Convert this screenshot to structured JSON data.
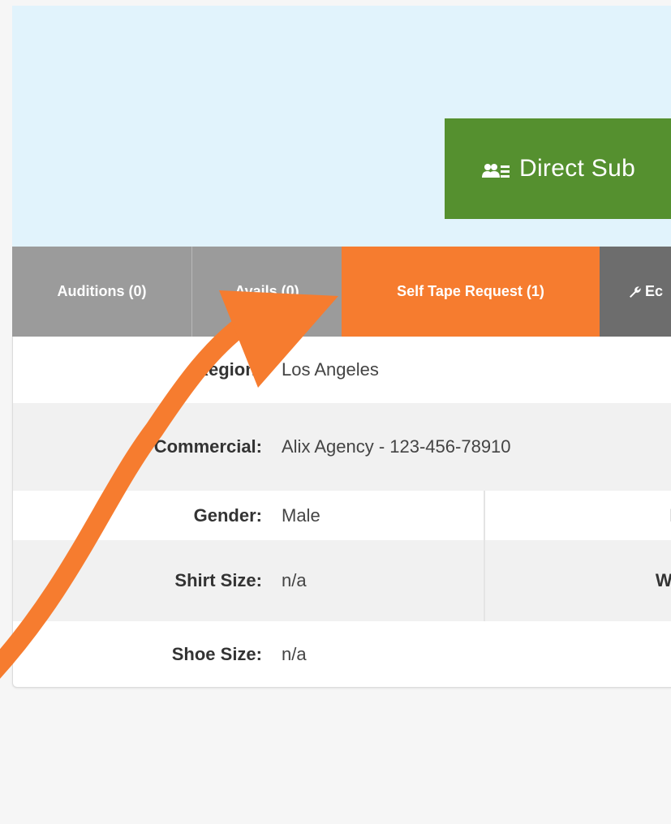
{
  "hero": {
    "direct_button_label": "Direct Sub"
  },
  "tabs": [
    {
      "label": "Auditions (0)"
    },
    {
      "label": "Avails (0)"
    },
    {
      "label": "Self Tape Request (1)"
    },
    {
      "label": "Ec"
    }
  ],
  "details": {
    "region": {
      "label": "Region:",
      "value": "Los Angeles"
    },
    "commercial": {
      "label": "Commercial:",
      "value": "Alix Agency - 123-456-78910"
    },
    "gender": {
      "label": "Gender:",
      "value": "Male",
      "right_label": "E"
    },
    "shirt_size": {
      "label": "Shirt Size:",
      "value": "n/a",
      "right_label": "Wa"
    },
    "shoe_size": {
      "label": "Shoe Size:",
      "value": "n/a"
    }
  },
  "colors": {
    "direct_button": "#55902f",
    "active_tab": "#f67c2f",
    "inactive_tab": "#9b9b9b",
    "edit_tab": "#6d6d6d",
    "hero_bg": "#e1f3fc",
    "arrow": "#f67c2f"
  },
  "icons": {
    "direct_button_icon": "users-list-icon",
    "edit_tab_icon": "wrench-icon",
    "annotation": "arrow-icon"
  }
}
